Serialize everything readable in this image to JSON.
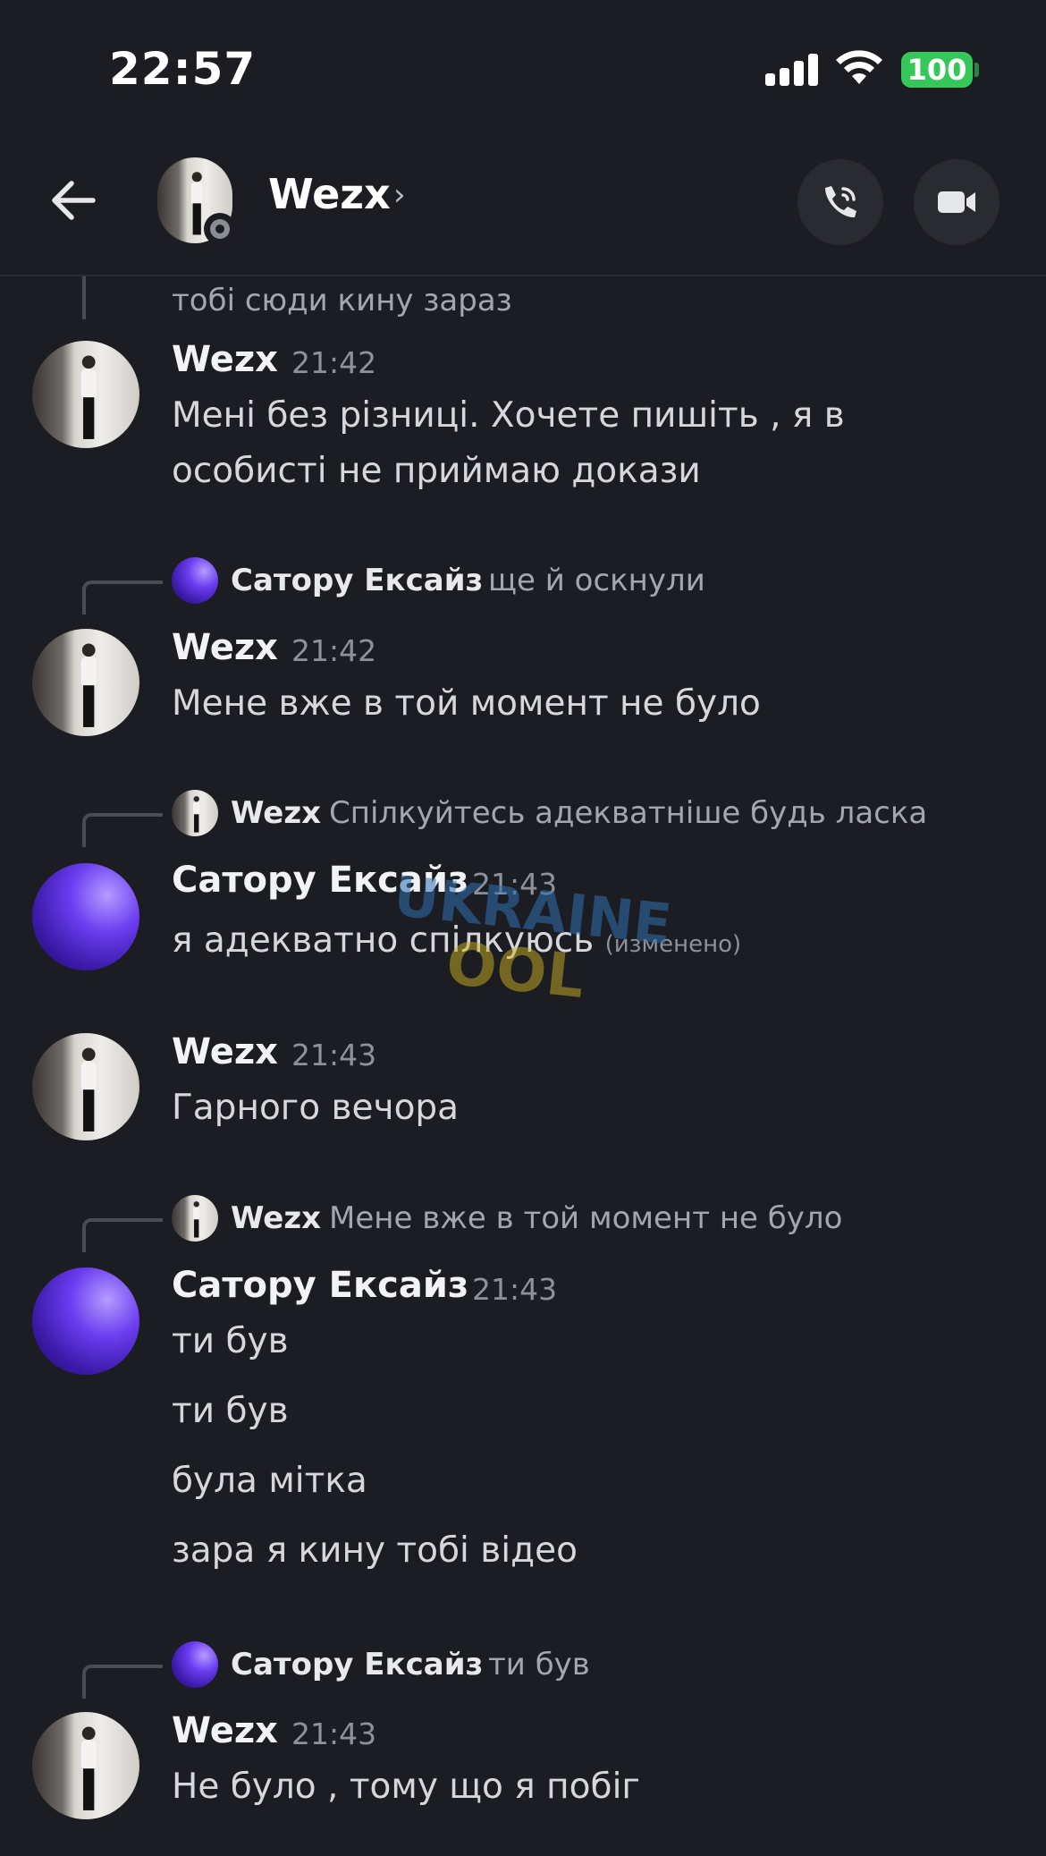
{
  "status_bar": {
    "time": "22:57",
    "battery": "100",
    "battery_color": "#35c759"
  },
  "header": {
    "title": "Wezx",
    "chevron": "›",
    "icons": [
      "back-arrow-icon",
      "phone-call-icon",
      "video-camera-icon"
    ]
  },
  "messages": {
    "top_fragment": "тобі сюди кину зараз",
    "m1": {
      "user": "Wezx",
      "time": "21:42",
      "line1": "Мені без різниці. Хочете пишіть , я в",
      "line2": "особисті не приймаю докази"
    },
    "m2": {
      "reply_user": "Сатору Ексайз",
      "reply_text": "ще й оскнули",
      "user": "Wezx",
      "time": "21:42",
      "line1": "Мене вже в той момент не було"
    },
    "m3": {
      "reply_user": "Wezx",
      "reply_text": "Спілкуйтесь адекватніше будь ласка",
      "user": "Сатору Ексайз",
      "time": "21:43",
      "line1": "я адекватно спілкуюсь",
      "edited": "(изменено)"
    },
    "m4": {
      "user": "Wezx",
      "time": "21:43",
      "line1": "Гарного вечора"
    },
    "m5": {
      "reply_user": "Wezx",
      "reply_text": "Мене вже в той момент не було",
      "user": "Сатору Ексайз",
      "time": "21:43",
      "lines": [
        "ти був",
        "ти був",
        "була мітка",
        "зара я кину тобі відео"
      ]
    },
    "m6": {
      "reply_user": "Сатору Ексайз",
      "reply_text": "ти був",
      "user": "Wezx",
      "time": "21:43",
      "line1": "Не було , тому що я побіг"
    }
  },
  "watermark": {
    "line1": "UKRAINE",
    "line2": "OOL"
  }
}
